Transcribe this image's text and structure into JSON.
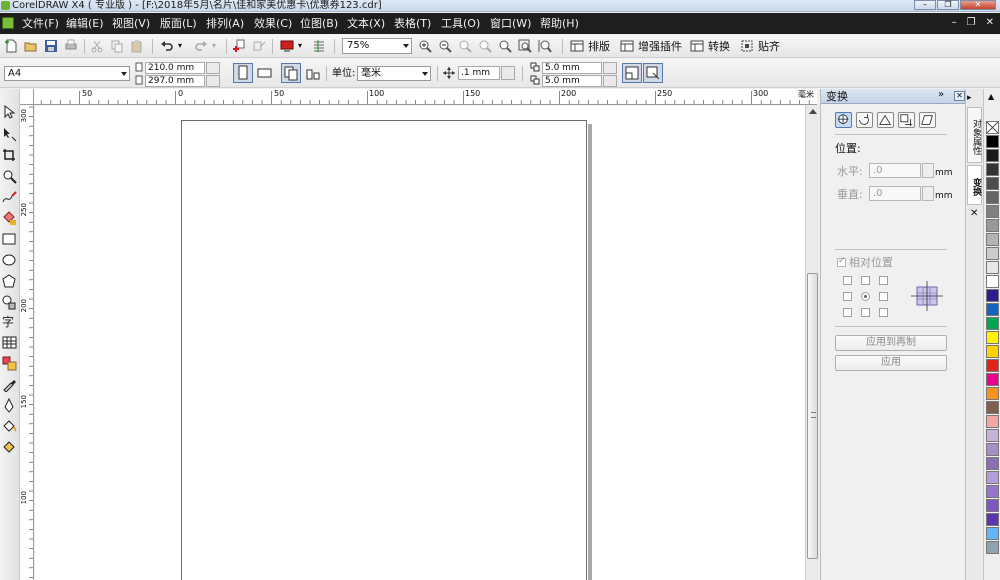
{
  "window": {
    "title": "CorelDRAW X4 ( 专业版 ) - [F:\\2018年5月\\名片\\佳和家美优惠卡\\优惠券123.cdr]",
    "controls": [
      "minimize-icon",
      "restore-icon",
      "close-icon"
    ]
  },
  "menu": {
    "items": [
      "文件(F)",
      "编辑(E)",
      "视图(V)",
      "版面(L)",
      "排列(A)",
      "效果(C)",
      "位图(B)",
      "文本(X)",
      "表格(T)",
      "工具(O)",
      "窗口(W)",
      "帮助(H)"
    ],
    "doc_controls": [
      "minimize-icon",
      "restore-icon",
      "close-icon"
    ]
  },
  "toolbar": {
    "zoom": "75%",
    "buttons": [
      "排版",
      "增强插件",
      "转换",
      "贴齐"
    ]
  },
  "property_bar": {
    "paper_size": "A4",
    "width": "210.0 mm",
    "height": "297.0 mm",
    "unit_label": "单位:",
    "unit_value": "毫米",
    "nudge": ".1 mm",
    "dup_x": "5.0 mm",
    "dup_y": "5.0 mm"
  },
  "rulers": {
    "top_ticks": [
      "50",
      "0",
      "50",
      "100",
      "150",
      "200",
      "250",
      "300",
      "毫米"
    ],
    "left_ticks": [
      "300",
      "250",
      "200",
      "150",
      "100"
    ]
  },
  "docker": {
    "title": "变换",
    "section": "位置:",
    "h_label": "水平:",
    "h_value": ".0",
    "v_label": "垂直:",
    "v_value": ".0",
    "unit": "mm",
    "relative": "相对位置",
    "apply_dup": "应用到再制",
    "apply": "应用"
  },
  "side_tabs": [
    "对象属性",
    "变换"
  ],
  "palette": {
    "colors": [
      "#ffffff",
      "#000000",
      "#1a1a1a",
      "#333333",
      "#4d4d4d",
      "#666666",
      "#808080",
      "#999999",
      "#b3b3b3",
      "#cccccc",
      "#e6e6e6",
      "#ffffff",
      "#2b1d8f",
      "#1565c0",
      "#00a651",
      "#fff200",
      "#ffd200",
      "#e2231a",
      "#ec008c",
      "#f7931e",
      "#7f5f4f",
      "#f4a6a6",
      "#c7b3d9",
      "#a58fc4",
      "#8f6fb3",
      "#b39ddb",
      "#9575cd",
      "#7e57c2",
      "#5e35b1",
      "#64b5f6",
      "#90a4ae"
    ]
  }
}
